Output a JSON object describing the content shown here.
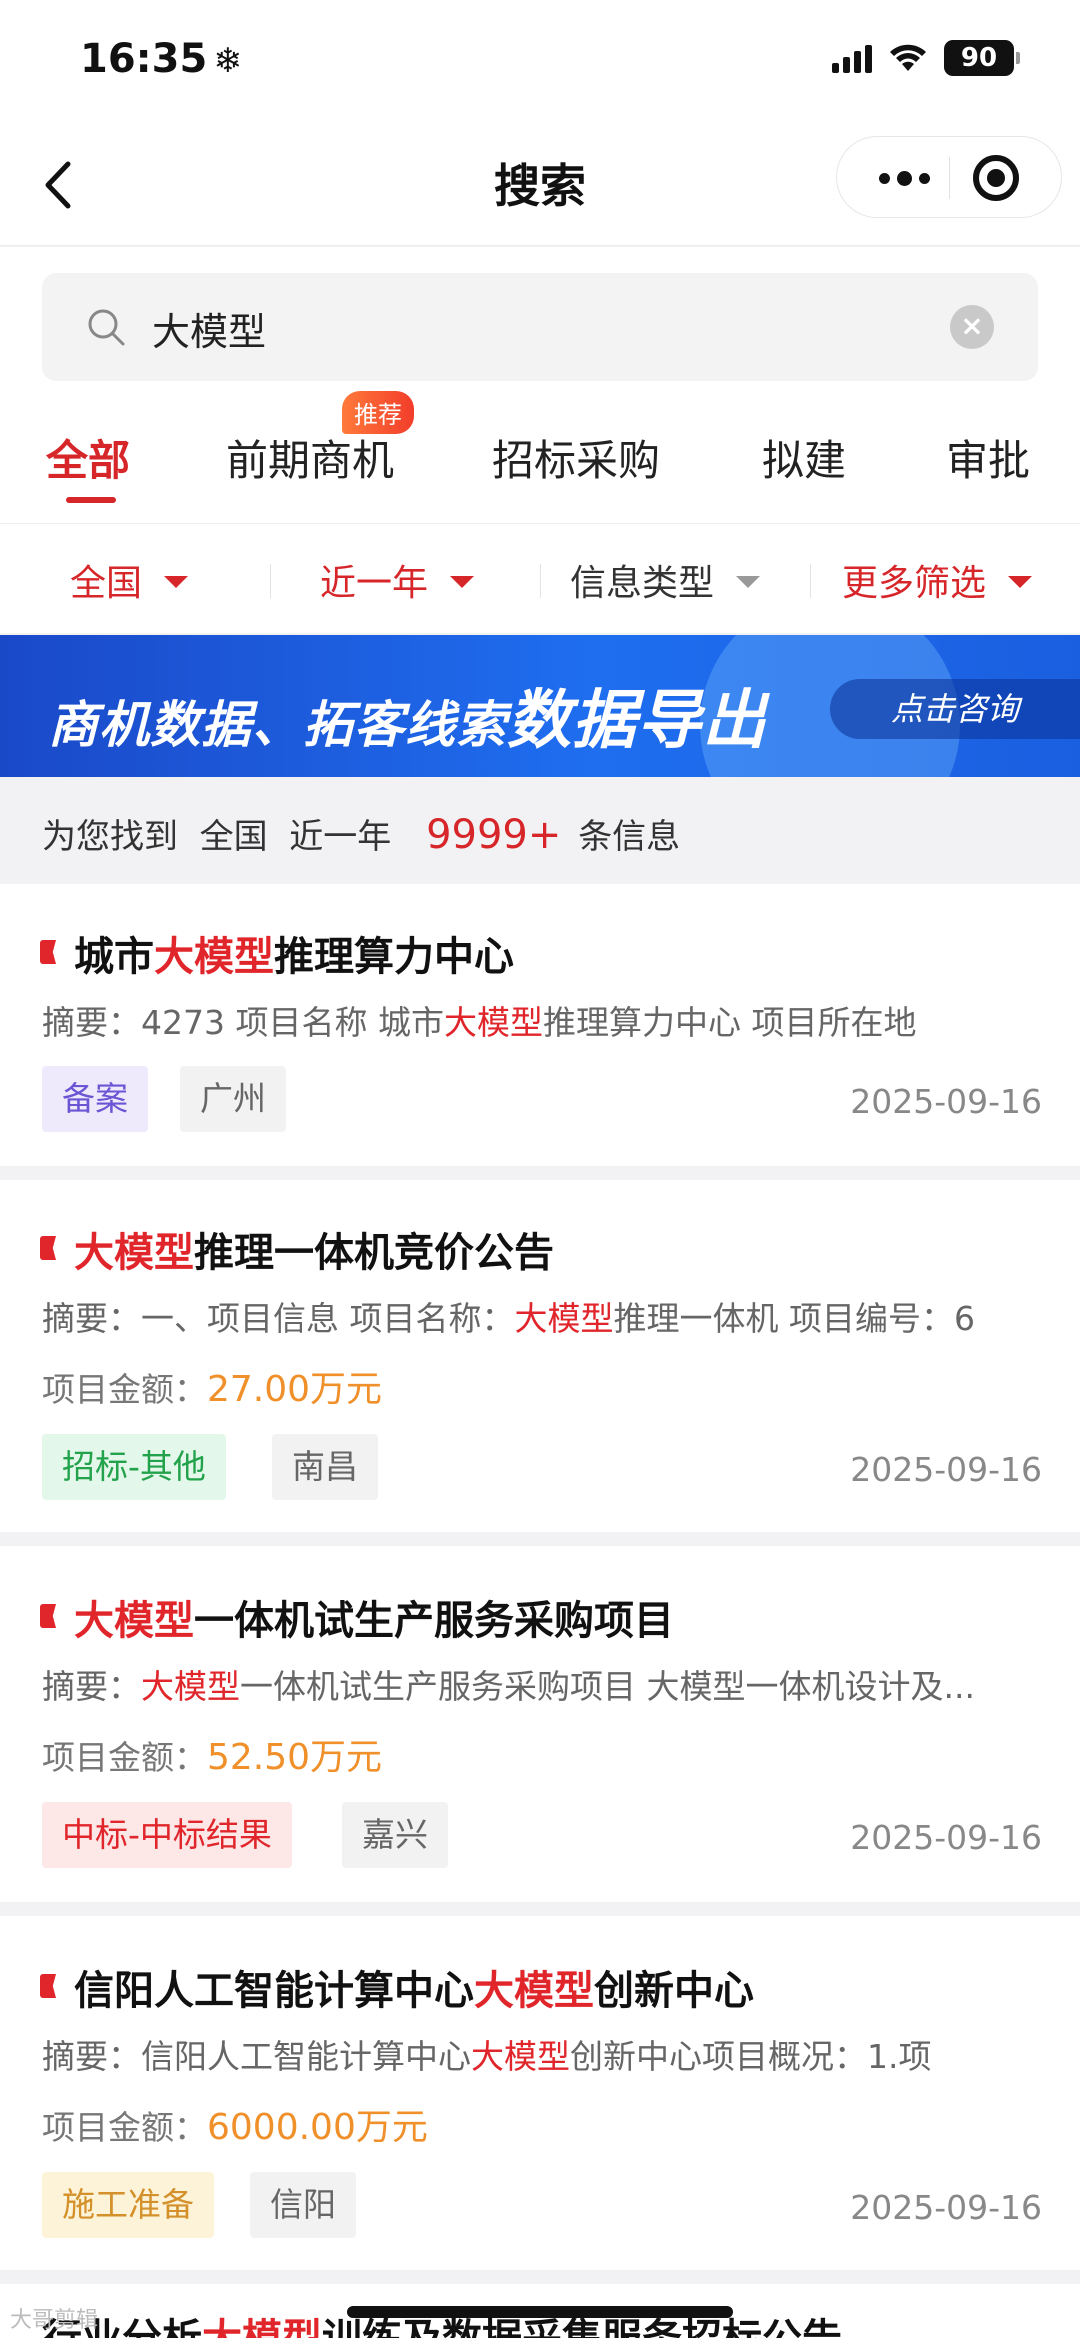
{
  "status_bar": {
    "time": "16:35",
    "weather_glyph": "❄",
    "battery": "90"
  },
  "nav": {
    "title": "搜索"
  },
  "search": {
    "value": "大模型",
    "clear_glyph": "×"
  },
  "tabs": [
    {
      "label": "全部",
      "active": true
    },
    {
      "label": "前期商机",
      "badge": "推荐"
    },
    {
      "label": "招标采购"
    },
    {
      "label": "拟建"
    },
    {
      "label": "审批"
    }
  ],
  "filters": [
    {
      "label": "全国",
      "color": "#d6262a"
    },
    {
      "label": "近一年",
      "color": "#d6262a"
    },
    {
      "label": "信息类型",
      "color": "#333333"
    },
    {
      "label": "更多筛选",
      "color": "#d6262a"
    }
  ],
  "banner": {
    "text": "商机数据、拓客线索",
    "big_text": "数据导出",
    "button": "点击咨询"
  },
  "summary": {
    "prefix": "为您找到",
    "region": "全国",
    "period": "近一年",
    "count": "9999+",
    "suffix": "条信息"
  },
  "results": [
    {
      "title_pre": "城市",
      "title_hl": "大模型",
      "title_post": "推理算力中心",
      "abstract_label": "摘要：",
      "abstract_pre": "4273 项目名称 城市",
      "abstract_hl": "大模型",
      "abstract_post": "推理算力中心 项目所在地",
      "tag": "备案",
      "tag_style": "purple",
      "location": "广州",
      "date": "2025-09-16"
    },
    {
      "title_pre": "",
      "title_hl": "大模型",
      "title_post": "推理一体机竞价公告",
      "abstract_label": "摘要：",
      "abstract_pre": "一、项目信息 项目名称：",
      "abstract_hl": "大模型",
      "abstract_post": "推理一体机 项目编号：6",
      "amount_label": "项目金额：",
      "amount": "27.00万元",
      "tag": "招标-其他",
      "tag_style": "green",
      "location": "南昌",
      "date": "2025-09-16"
    },
    {
      "title_pre": "",
      "title_hl": "大模型",
      "title_post": "一体机试生产服务采购项目",
      "abstract_label": "摘要：",
      "abstract_pre": "",
      "abstract_hl": "大模型",
      "abstract_post": "一体机试生产服务采购项目 大模型一体机设计及...",
      "amount_label": "项目金额：",
      "amount": "52.50万元",
      "tag": "中标-中标结果",
      "tag_style": "pink",
      "location": "嘉兴",
      "date": "2025-09-16"
    },
    {
      "title_pre": "信阳人工智能计算中心",
      "title_hl": "大模型",
      "title_post": "创新中心",
      "abstract_label": "摘要：",
      "abstract_pre": "信阳人工智能计算中心",
      "abstract_hl": "大模型",
      "abstract_post": "创新中心项目概况：1.项",
      "amount_label": "项目金额：",
      "amount": "6000.00万元",
      "tag": "施工准备",
      "tag_style": "yellow",
      "location": "信阳",
      "date": "2025-09-16"
    }
  ],
  "next_preview": {
    "pre": "行业分析",
    "hl": "大模型",
    "post": "训练及数据采集服务招标公告"
  },
  "watermark": "大哥剪辑"
}
